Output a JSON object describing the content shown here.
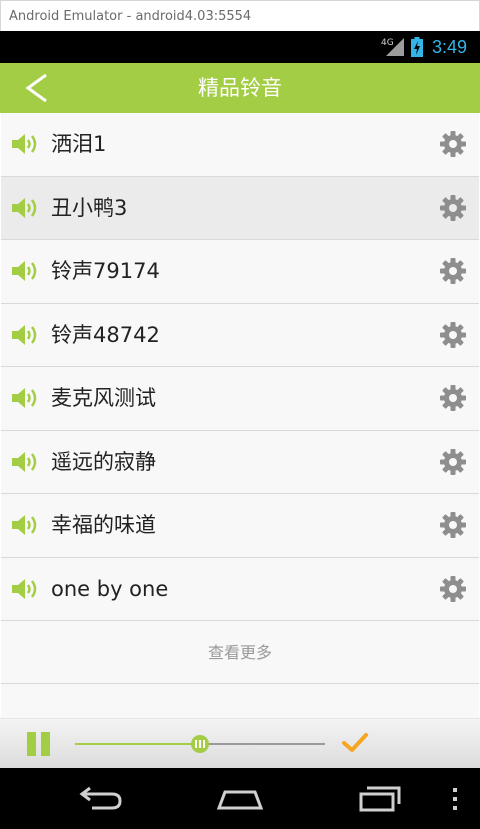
{
  "window": {
    "title": "Android Emulator - android4.03:5554"
  },
  "status_bar": {
    "network": "4G",
    "time": "3:49",
    "clock_color": "#33b5e5"
  },
  "app_bar": {
    "title": "精品铃音",
    "color": "#a3cd44",
    "back_icon": "chevron-left-icon"
  },
  "ringtones": [
    {
      "name": "洒泪1"
    },
    {
      "name": "丑小鸭3"
    },
    {
      "name": "铃声79174"
    },
    {
      "name": "铃声48742"
    },
    {
      "name": "麦克风测试"
    },
    {
      "name": "遥远的寂静"
    },
    {
      "name": "幸福的味道"
    },
    {
      "name": "one by one"
    }
  ],
  "row_icons": {
    "left": "speaker-icon",
    "right": "gear-icon"
  },
  "load_more": {
    "label": "查看更多"
  },
  "player": {
    "progress": 0.5,
    "play_state_icon": "pause-icon",
    "confirm_icon": "checkmark-icon"
  },
  "nav_bar": {
    "icons": [
      "back-icon",
      "home-icon",
      "recent-apps-icon",
      "overflow-menu-icon"
    ]
  }
}
